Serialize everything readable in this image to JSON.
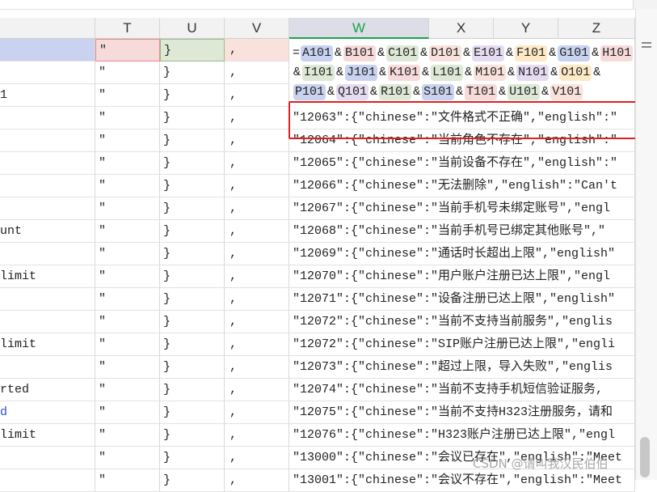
{
  "columns": [
    {
      "id": "S",
      "label": ""
    },
    {
      "id": "T",
      "label": "T"
    },
    {
      "id": "U",
      "label": "U"
    },
    {
      "id": "V",
      "label": "V"
    },
    {
      "id": "W",
      "label": "W"
    },
    {
      "id": "X",
      "label": "X"
    },
    {
      "id": "Y",
      "label": "Y"
    },
    {
      "id": "Z",
      "label": "Z"
    }
  ],
  "formula": {
    "eq": "=",
    "refs": [
      {
        "text": "A101",
        "color": "#c9d3f0"
      },
      {
        "text": "B101",
        "color": "#f7dada"
      },
      {
        "text": "C101",
        "color": "#dde8d6"
      },
      {
        "text": "D101",
        "color": "#f9e2dc"
      },
      {
        "text": "E101",
        "color": "#e6dcf1"
      },
      {
        "text": "F101",
        "color": "#fde9c6"
      },
      {
        "text": "G101",
        "color": "#c9d3f0"
      },
      {
        "text": "H101",
        "color": "#f7dada"
      },
      {
        "text": "I101",
        "color": "#dde8d6"
      },
      {
        "text": "J101",
        "color": "#c9d3f0"
      },
      {
        "text": "K101",
        "color": "#f7dada"
      },
      {
        "text": "L101",
        "color": "#dde8d6"
      },
      {
        "text": "M101",
        "color": "#f9e2dc"
      },
      {
        "text": "N101",
        "color": "#e6dcf1"
      },
      {
        "text": "O101",
        "color": "#fde9c6"
      },
      {
        "text": "P101",
        "color": "#c9d3f0"
      },
      {
        "text": "Q101",
        "color": "#e6dcf1"
      },
      {
        "text": "R101",
        "color": "#dde8d6"
      },
      {
        "text": "S101",
        "color": "#c9d3f0"
      },
      {
        "text": "T101",
        "color": "#f7dada"
      },
      {
        "text": "U101",
        "color": "#dde8d6"
      },
      {
        "text": "V101",
        "color": "#f9e2dc"
      }
    ],
    "amp": "&"
  },
  "rows": [
    {
      "s": "",
      "t": "\"",
      "u": "}",
      "v": ",",
      "w": ""
    },
    {
      "s": "",
      "t": "\"",
      "u": "}",
      "v": ",",
      "w": ""
    },
    {
      "s": "1",
      "t": "\"",
      "u": "}",
      "v": ",",
      "w": ""
    },
    {
      "s": "",
      "t": "\"",
      "u": "}",
      "v": ",",
      "w": "\"12063\":{\"chinese\":\"文件格式不正确\",\"english\":\""
    },
    {
      "s": "",
      "t": "\"",
      "u": "}",
      "v": ",",
      "w": "\"12064\":{\"chinese\":\"当前角色不存在\",\"english\":\""
    },
    {
      "s": "",
      "t": "\"",
      "u": "}",
      "v": ",",
      "w": "\"12065\":{\"chinese\":\"当前设备不存在\",\"english\":\""
    },
    {
      "s": "",
      "t": "\"",
      "u": "}",
      "v": ",",
      "w": "\"12066\":{\"chinese\":\"无法删除\",\"english\":\"Can't"
    },
    {
      "s": "",
      "t": "\"",
      "u": "}",
      "v": ",",
      "w": "\"12067\":{\"chinese\":\"当前手机号未绑定账号\",\"engl"
    },
    {
      "s": "unt",
      "t": "\"",
      "u": "}",
      "v": ",",
      "w": "\"12068\":{\"chinese\":\"当前手机号已绑定其他账号\",\""
    },
    {
      "s": "",
      "t": "\"",
      "u": "}",
      "v": ",",
      "w": "\"12069\":{\"chinese\":\"通话时长超出上限\",\"english\""
    },
    {
      "s": " limit",
      "t": "\"",
      "u": "}",
      "v": ",",
      "w": "\"12070\":{\"chinese\":\"用户账户注册已达上限\",\"engl"
    },
    {
      "s": "",
      "t": "\"",
      "u": "}",
      "v": ",",
      "w": "\"12071\":{\"chinese\":\"设备注册已达上限\",\"english\""
    },
    {
      "s": "",
      "t": "\"",
      "u": "}",
      "v": ",",
      "w": "\"12072\":{\"chinese\":\"当前不支持当前服务\",\"englis"
    },
    {
      "s": "limit",
      "t": "\"",
      "u": "}",
      "v": ",",
      "w": "\"12072\":{\"chinese\":\"SIP账户注册已达上限\",\"engli"
    },
    {
      "s": "",
      "t": "\"",
      "u": "}",
      "v": ",",
      "w": "\"12073\":{\"chinese\":\"超过上限，导入失败\",\"englis"
    },
    {
      "s": "rted",
      "t": "\"",
      "u": "}",
      "v": ",",
      "w": "\"12074\":{\"chinese\":\"当前不支持手机短信验证服务,"
    },
    {
      "s": "d",
      "t": "\"",
      "u": "}",
      "v": ",",
      "w": "\"12075\":{\"chinese\":\"当前不支持H323注册服务，请和"
    },
    {
      "s": " limit",
      "t": "\"",
      "u": "}",
      "v": ",",
      "w": "\"12076\":{\"chinese\":\"H323账户注册已达上限\",\"engl"
    },
    {
      "s": "",
      "t": "\"",
      "u": "}",
      "v": ",",
      "w": "\"13000\":{\"chinese\":\"会议已存在\",\"english\":\"Meet"
    },
    {
      "s": "",
      "t": "\"",
      "u": "}",
      "v": ",",
      "w": "\"13001\":{\"chinese\":\"会议不存在\",\"english\":\"Meet"
    }
  ],
  "watermark": "CSDN @请叫我汉民伯伯",
  "colors": {
    "active_column": "#17a34a",
    "highlight": "#e02020"
  }
}
